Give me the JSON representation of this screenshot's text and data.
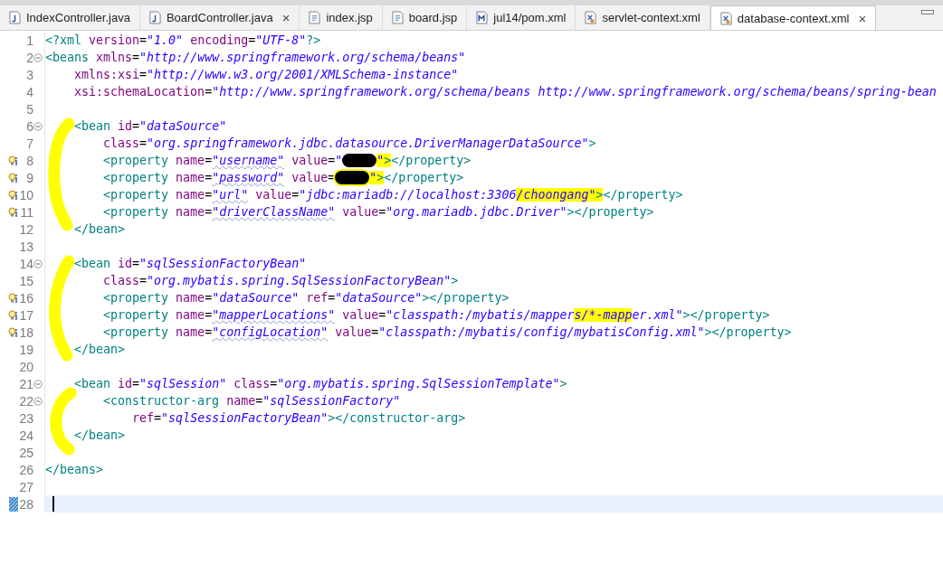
{
  "tabs": [
    {
      "label": "IndexController.java",
      "kind": "java",
      "selected": false
    },
    {
      "label": "BoardController.java",
      "kind": "java",
      "selected": false,
      "close": "×"
    },
    {
      "label": "index.jsp",
      "kind": "jsp",
      "selected": false
    },
    {
      "label": "board.jsp",
      "kind": "jsp",
      "selected": false
    },
    {
      "label": "jul14/pom.xml",
      "kind": "maven",
      "selected": false
    },
    {
      "label": "servlet-context.xml",
      "kind": "xml",
      "selected": false
    },
    {
      "label": "database-context.xml",
      "kind": "xml",
      "selected": true,
      "close": "×"
    }
  ],
  "editor": {
    "lines": [
      {
        "n": "1",
        "tokens": [
          {
            "kind": "tag",
            "text": "<?xml"
          },
          {
            "kind": "attr",
            "text": " version"
          },
          {
            "kind": "eq",
            "text": "="
          },
          {
            "kind": "str",
            "text": "\"1.0\""
          },
          {
            "kind": "attr",
            "text": " encoding"
          },
          {
            "kind": "eq",
            "text": "="
          },
          {
            "kind": "str",
            "text": "\"UTF-8\""
          },
          {
            "kind": "tag",
            "text": "?>"
          }
        ]
      },
      {
        "n": "2",
        "kind": "fold",
        "tokens": [
          {
            "kind": "tag",
            "text": "<beans"
          },
          {
            "kind": "attr",
            "text": " xmlns"
          },
          {
            "kind": "eq",
            "text": "="
          },
          {
            "kind": "str",
            "text": "\"http://www.springframework.org/schema/beans\""
          }
        ]
      },
      {
        "n": "3",
        "tokens": [
          {
            "kind": "attr",
            "text": "    xmlns:xsi"
          },
          {
            "kind": "eq",
            "text": "="
          },
          {
            "kind": "str",
            "text": "\"http://www.w3.org/2001/XMLSchema-instance\""
          }
        ]
      },
      {
        "n": "4",
        "tokens": [
          {
            "kind": "attr",
            "text": "    xsi:schemaLocation"
          },
          {
            "kind": "eq",
            "text": "="
          },
          {
            "kind": "str",
            "text": "\"http://www.springframework.org/schema/beans http://www.springframework.org/schema/beans/spring-bean"
          }
        ]
      },
      {
        "n": "5"
      },
      {
        "n": "6",
        "kind": "fold",
        "tokens": [
          {
            "kind": "tag",
            "text": "    <bean"
          },
          {
            "kind": "attr",
            "text": " id"
          },
          {
            "kind": "eq",
            "text": "="
          },
          {
            "kind": "str",
            "text": "\"dataSource\""
          }
        ]
      },
      {
        "n": "7",
        "tokens": [
          {
            "kind": "attr",
            "text": "        class"
          },
          {
            "kind": "eq",
            "text": "="
          },
          {
            "kind": "str",
            "text": "\"org.springframework.jdbc.datasource.DriverManagerDataSource\""
          },
          {
            "kind": "tag",
            "text": ">"
          }
        ]
      },
      {
        "n": "8",
        "kind": "bulb",
        "tokens": [
          {
            "kind": "tag",
            "text": "        <property"
          },
          {
            "kind": "attr",
            "text": " name"
          },
          {
            "kind": "eq",
            "text": "="
          },
          {
            "kind": "str",
            "text": "\"username\"",
            "squiggle": true
          },
          {
            "kind": "attr",
            "text": " value"
          },
          {
            "kind": "eq",
            "text": "="
          },
          {
            "kind": "str",
            "text": "\""
          },
          {
            "kind": "redacted",
            "highlight": false
          },
          {
            "kind": "str",
            "text": "\"",
            "highlight": true
          },
          {
            "kind": "tag",
            "text": ">",
            "highlight": true
          },
          {
            "kind": "tag",
            "text": "</property>"
          }
        ]
      },
      {
        "n": "9",
        "kind": "bulb",
        "tokens": [
          {
            "kind": "tag",
            "text": "        <property"
          },
          {
            "kind": "attr",
            "text": " name"
          },
          {
            "kind": "eq",
            "text": "="
          },
          {
            "kind": "str",
            "text": "\"password\"",
            "squiggle": true
          },
          {
            "kind": "attr",
            "text": " value"
          },
          {
            "kind": "eq",
            "text": "="
          },
          {
            "kind": "redacted",
            "highlight": true
          },
          {
            "kind": "str",
            "text": "\"",
            "highlight": true
          },
          {
            "kind": "tag",
            "text": ">",
            "highlight": true
          },
          {
            "kind": "tag",
            "text": "</property>"
          }
        ]
      },
      {
        "n": "10",
        "kind": "bulb",
        "tokens": [
          {
            "kind": "tag",
            "text": "        <property"
          },
          {
            "kind": "attr",
            "text": " name"
          },
          {
            "kind": "eq",
            "text": "="
          },
          {
            "kind": "str",
            "text": "\"url\"",
            "squiggle": true
          },
          {
            "kind": "attr",
            "text": " value"
          },
          {
            "kind": "eq",
            "text": "="
          },
          {
            "kind": "str",
            "text": "\"jdbc:mariadb://localhost:3306"
          },
          {
            "kind": "str",
            "text": "/choongang\"",
            "highlight": true
          },
          {
            "kind": "tag",
            "text": ">",
            "highlight": true
          },
          {
            "kind": "tag",
            "text": "</property>"
          }
        ]
      },
      {
        "n": "11",
        "kind": "bulb",
        "tokens": [
          {
            "kind": "tag",
            "text": "        <property"
          },
          {
            "kind": "attr",
            "text": " name"
          },
          {
            "kind": "eq",
            "text": "="
          },
          {
            "kind": "str",
            "text": "\"driverClassName\"",
            "squiggle": true
          },
          {
            "kind": "attr",
            "text": " value"
          },
          {
            "kind": "eq",
            "text": "="
          },
          {
            "kind": "str",
            "text": "\"org.mariadb.jdbc.Driver\""
          },
          {
            "kind": "tag",
            "text": "></property>"
          }
        ]
      },
      {
        "n": "12",
        "tokens": [
          {
            "kind": "tag",
            "text": "    </bean>"
          }
        ]
      },
      {
        "n": "13"
      },
      {
        "n": "14",
        "kind": "fold",
        "tokens": [
          {
            "kind": "tag",
            "text": "    <bean"
          },
          {
            "kind": "attr",
            "text": " id"
          },
          {
            "kind": "eq",
            "text": "="
          },
          {
            "kind": "str",
            "text": "\"sqlSessionFactoryBean\""
          }
        ]
      },
      {
        "n": "15",
        "tokens": [
          {
            "kind": "attr",
            "text": "        class"
          },
          {
            "kind": "eq",
            "text": "="
          },
          {
            "kind": "str",
            "text": "\"org.mybatis.spring.SqlSessionFactoryBean\""
          },
          {
            "kind": "tag",
            "text": ">"
          }
        ]
      },
      {
        "n": "16",
        "kind": "bulb",
        "tokens": [
          {
            "kind": "tag",
            "text": "        <property"
          },
          {
            "kind": "attr",
            "text": " name"
          },
          {
            "kind": "eq",
            "text": "="
          },
          {
            "kind": "str",
            "text": "\"dataSource\""
          },
          {
            "kind": "attr",
            "text": " ref"
          },
          {
            "kind": "eq",
            "text": "="
          },
          {
            "kind": "str",
            "text": "\"dataSource\""
          },
          {
            "kind": "tag",
            "text": "></property>"
          }
        ]
      },
      {
        "n": "17",
        "kind": "bulb",
        "tokens": [
          {
            "kind": "tag",
            "text": "        <property"
          },
          {
            "kind": "attr",
            "text": " name"
          },
          {
            "kind": "eq",
            "text": "="
          },
          {
            "kind": "str",
            "text": "\"mapperLocations\"",
            "squiggle": true
          },
          {
            "kind": "attr",
            "text": " value"
          },
          {
            "kind": "eq",
            "text": "="
          },
          {
            "kind": "str",
            "text": "\"classpath:/mybatis/mapper"
          },
          {
            "kind": "str",
            "text": "s/*-mapp",
            "highlight": true
          },
          {
            "kind": "str",
            "text": "er.xml\""
          },
          {
            "kind": "tag",
            "text": "></property>"
          }
        ]
      },
      {
        "n": "18",
        "kind": "bulb",
        "tokens": [
          {
            "kind": "tag",
            "text": "        <property"
          },
          {
            "kind": "attr",
            "text": " name"
          },
          {
            "kind": "eq",
            "text": "="
          },
          {
            "kind": "str",
            "text": "\"configLocation\"",
            "squiggle": true
          },
          {
            "kind": "attr",
            "text": " value"
          },
          {
            "kind": "eq",
            "text": "="
          },
          {
            "kind": "str",
            "text": "\"classpath:/mybatis/config/mybatisConfig.xml\""
          },
          {
            "kind": "tag",
            "text": "></property>"
          }
        ]
      },
      {
        "n": "19",
        "tokens": [
          {
            "kind": "tag",
            "text": "    </bean>"
          }
        ]
      },
      {
        "n": "20"
      },
      {
        "n": "21",
        "kind": "fold",
        "tokens": [
          {
            "kind": "tag",
            "text": "    <bean"
          },
          {
            "kind": "attr",
            "text": " id"
          },
          {
            "kind": "eq",
            "text": "="
          },
          {
            "kind": "str",
            "text": "\"sqlSession\""
          },
          {
            "kind": "attr",
            "text": " class"
          },
          {
            "kind": "eq",
            "text": "="
          },
          {
            "kind": "str",
            "text": "\"org.mybatis.spring.SqlSessionTemplate\""
          },
          {
            "kind": "tag",
            "text": ">"
          }
        ]
      },
      {
        "n": "22",
        "kind": "fold",
        "tokens": [
          {
            "kind": "tag",
            "text": "        <constructor-arg"
          },
          {
            "kind": "attr",
            "text": " name"
          },
          {
            "kind": "eq",
            "text": "="
          },
          {
            "kind": "str",
            "text": "\"sqlSessionFactory\""
          }
        ]
      },
      {
        "n": "23",
        "tokens": [
          {
            "kind": "attr",
            "text": "            ref"
          },
          {
            "kind": "eq",
            "text": "="
          },
          {
            "kind": "str",
            "text": "\"sqlSessionFactoryBean\""
          },
          {
            "kind": "tag",
            "text": "></constructor-arg>"
          }
        ]
      },
      {
        "n": "24",
        "tokens": [
          {
            "kind": "tag",
            "text": "    </bean>"
          }
        ]
      },
      {
        "n": "25"
      },
      {
        "n": "26",
        "tokens": [
          {
            "kind": "tag",
            "text": "</beans>"
          }
        ]
      },
      {
        "n": "27"
      },
      {
        "n": "28",
        "current": true,
        "kind": "change"
      }
    ]
  }
}
